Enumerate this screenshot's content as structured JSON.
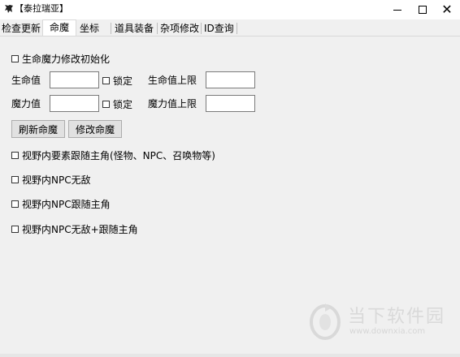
{
  "window": {
    "title": "【泰拉瑞亚】",
    "minimize_icon": "minimize-icon",
    "maximize_icon": "maximize-icon",
    "close_icon": "close-icon"
  },
  "tabs": [
    {
      "label": "检查更新",
      "active": false
    },
    {
      "label": "命魔",
      "active": true
    },
    {
      "label": "坐标",
      "active": false
    },
    {
      "label": "道具装备",
      "active": false
    },
    {
      "label": "杂项修改",
      "active": false
    },
    {
      "label": "ID查询",
      "active": false
    }
  ],
  "main": {
    "init_checkbox_label": "生命魔力修改初始化",
    "hp_label": "生命值",
    "hp_value": "",
    "hp_lock_label": "锁定",
    "hp_max_label": "生命值上限",
    "hp_max_value": "",
    "mp_label": "魔力值",
    "mp_value": "",
    "mp_lock_label": "锁定",
    "mp_max_label": "魔力值上限",
    "mp_max_value": "",
    "refresh_button": "刷新命魔",
    "modify_button": "修改命魔",
    "options": [
      "视野内要素跟随主角(怪物、NPC、召唤物等)",
      "视野内NPC无敌",
      "视野内NPC跟随主角",
      "视野内NPC无敌+跟随主角"
    ]
  },
  "watermark": {
    "text": "当下软件园",
    "url": "www.downxia.com",
    "logo_icon": "downxia-logo-icon"
  },
  "colors": {
    "window_bg": "#f0f0f0",
    "titlebar_bg": "#ffffff",
    "button_bg": "#e1e1e1"
  }
}
